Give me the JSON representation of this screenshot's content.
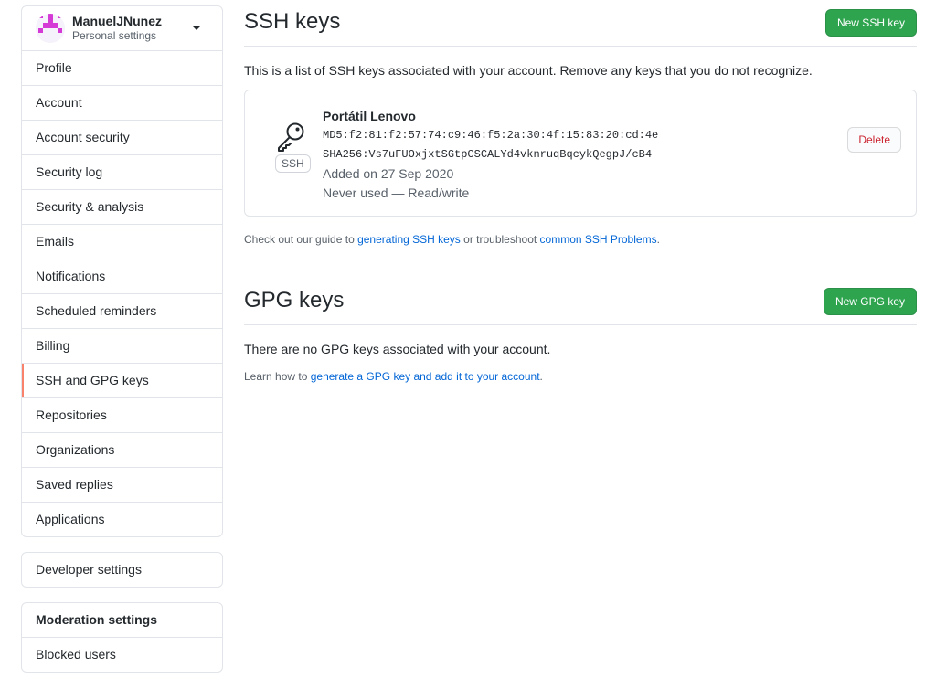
{
  "user": {
    "name": "ManuelJNunez",
    "subtitle": "Personal settings"
  },
  "sidebar": {
    "items": [
      {
        "label": "Profile"
      },
      {
        "label": "Account"
      },
      {
        "label": "Account security"
      },
      {
        "label": "Security log"
      },
      {
        "label": "Security & analysis"
      },
      {
        "label": "Emails"
      },
      {
        "label": "Notifications"
      },
      {
        "label": "Scheduled reminders"
      },
      {
        "label": "Billing"
      },
      {
        "label": "SSH and GPG keys",
        "selected": true
      },
      {
        "label": "Repositories"
      },
      {
        "label": "Organizations"
      },
      {
        "label": "Saved replies"
      },
      {
        "label": "Applications"
      }
    ],
    "developer_settings": "Developer settings",
    "moderation_heading": "Moderation settings",
    "blocked_users": "Blocked users"
  },
  "ssh": {
    "title": "SSH keys",
    "new_button": "New SSH key",
    "description": "This is a list of SSH keys associated with your account. Remove any keys that you do not recognize.",
    "key": {
      "icon": "key-icon",
      "badge": "SSH",
      "name": "Portátil Lenovo",
      "md5": "MD5:f2:81:f2:57:74:c9:46:f5:2a:30:4f:15:83:20:cd:4e",
      "sha256": "SHA256:Vs7uFUOxjxtSGtpCSCALYd4vknruqBqcykQegpJ/cB4",
      "added": "Added on 27 Sep 2020",
      "usage": "Never used — Read/write",
      "delete_button": "Delete"
    },
    "guide_prefix": "Check out our guide to ",
    "guide_link": "generating SSH keys",
    "guide_middle": " or troubleshoot ",
    "guide_link2": "common SSH Problems",
    "guide_suffix": "."
  },
  "gpg": {
    "title": "GPG keys",
    "new_button": "New GPG key",
    "empty": "There are no GPG keys associated with your account.",
    "learn_prefix": "Learn how to ",
    "learn_link": "generate a GPG key and add it to your account",
    "learn_suffix": "."
  },
  "colors": {
    "accent_green": "#2ea44f",
    "link": "#0366d6",
    "danger": "#cb2431",
    "selected_marker": "#f9826c",
    "avatar": "#d63ad6"
  }
}
